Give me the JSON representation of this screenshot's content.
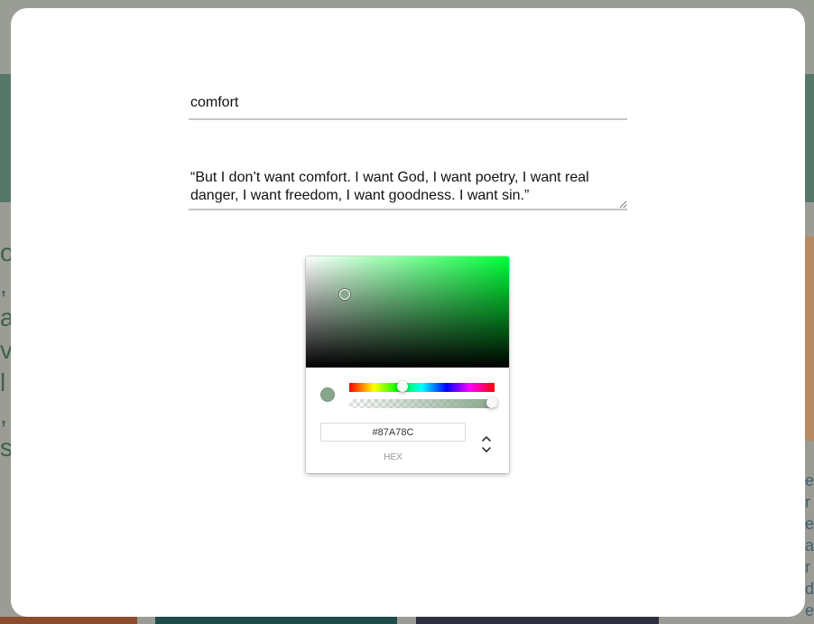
{
  "modal": {
    "title_value": "comfort",
    "quote_value": "“But I don’t want comfort. I want God, I want poetry, I want real danger, I want freedom, I want goodness. I want sin.”"
  },
  "color_picker": {
    "hex_value": "#87A78C",
    "hex_label": "HEX",
    "current_color": "#87A78C",
    "hue_color": "#00ff37",
    "mode_toggle_icon": "up-down-chevron-icon",
    "hue_level": 0.36,
    "alpha_level": 1.0
  }
}
